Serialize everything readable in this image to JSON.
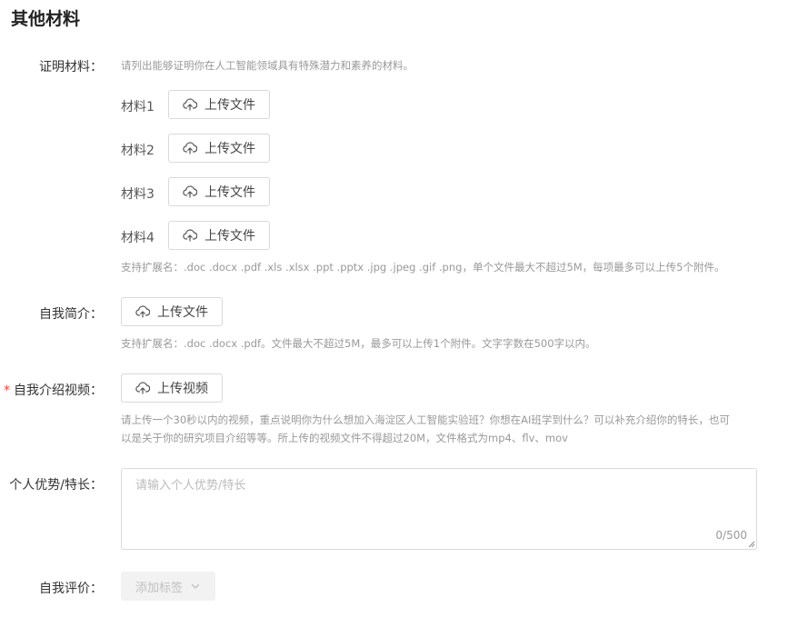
{
  "section_title": "其他材料",
  "proof": {
    "label": "证明材料：",
    "hint": "请列出能够证明你在人工智能领域具有特殊潜力和素养的材料。",
    "items": [
      {
        "label": "材料1",
        "button": "上传文件"
      },
      {
        "label": "材料2",
        "button": "上传文件"
      },
      {
        "label": "材料3",
        "button": "上传文件"
      },
      {
        "label": "材料4",
        "button": "上传文件"
      }
    ],
    "formats": "支持扩展名：.doc .docx .pdf .xls .xlsx .ppt .pptx .jpg .jpeg .gif .png，单个文件最大不超过5M，每项最多可以上传5个附件。"
  },
  "intro": {
    "label": "自我简介：",
    "button": "上传文件",
    "formats": "支持扩展名：.doc .docx .pdf。文件最大不超过5M，最多可以上传1个附件。文字字数在500字以内。"
  },
  "video": {
    "required_mark": "*",
    "label": "自我介绍视频：",
    "button": "上传视频",
    "hint_line1": "请上传一个30秒以内的视频，重点说明你为什么想加入海淀区人工智能实验班？你想在AI班学到什么？可以补充介绍你的特长，也可",
    "hint_line2": "以是关于你的研究项目介绍等等。所上传的视频文件不得超过20M，文件格式为mp4、flv、mov"
  },
  "strengths": {
    "label": "个人优势/特长：",
    "placeholder": "请输入个人优势/特长",
    "value": "",
    "counter": "0/500"
  },
  "evaluation": {
    "label": "自我评价：",
    "tag_placeholder": "添加标签"
  },
  "icons": {
    "upload": "upload-cloud-icon",
    "dropdown": "chevron-down-icon"
  }
}
